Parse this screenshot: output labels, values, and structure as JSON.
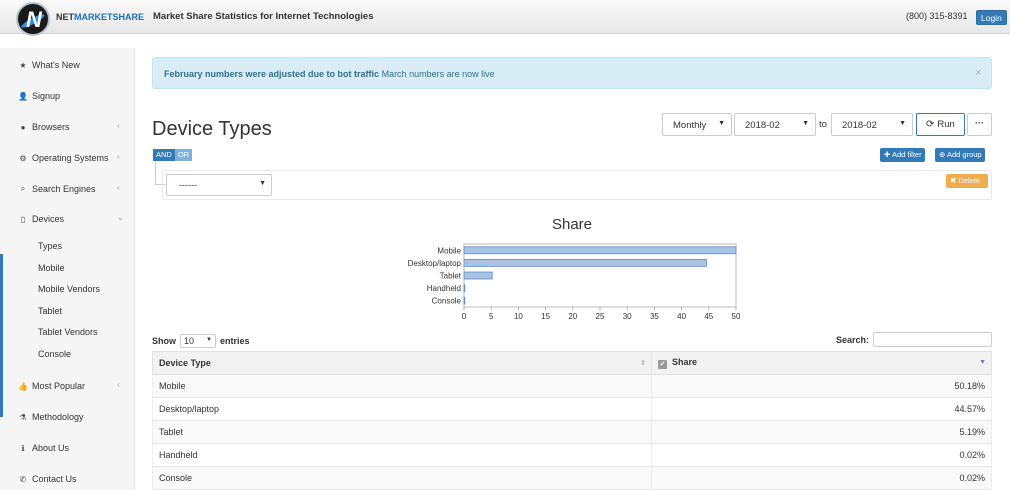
{
  "header": {
    "brand_part1": "NET",
    "brand_part2": "MARKETSHARE",
    "tagline": "Market Share Statistics for Internet Technologies",
    "phone": "(800) 315-8391",
    "login_label": "Login"
  },
  "sidebar": {
    "items": [
      {
        "label": "What's New",
        "icon": "star-icon"
      },
      {
        "label": "Signup",
        "icon": "user-plus-icon"
      },
      {
        "label": "Browsers",
        "icon": "globe-icon"
      },
      {
        "label": "Operating Systems",
        "icon": "cog-icon"
      },
      {
        "label": "Search Engines",
        "icon": "search-icon"
      },
      {
        "label": "Devices",
        "icon": "tablet-icon"
      },
      {
        "label": "Most Popular",
        "icon": "thumbs-up-icon"
      },
      {
        "label": "Methodology",
        "icon": "flask-icon"
      },
      {
        "label": "About Us",
        "icon": "info-icon"
      },
      {
        "label": "Contact Us",
        "icon": "phone-icon"
      }
    ],
    "devices_sub": [
      "Types",
      "Mobile",
      "Mobile Vendors",
      "Tablet",
      "Tablet Vendors",
      "Console"
    ]
  },
  "alert": {
    "bold_text": "February numbers were adjusted due to bot traffic",
    "text": "March numbers are now live",
    "close": "×"
  },
  "page_title": "Device Types",
  "controls": {
    "period": "Monthly",
    "from": "2018-02",
    "to_label": "to",
    "to": "2018-02",
    "run_label": "Run",
    "more_label": "···"
  },
  "filter": {
    "and_label": "AND",
    "or_label": "OR",
    "placeholder": "------",
    "add_filter": "Add filter",
    "add_group": "Add group",
    "delete": "Delete"
  },
  "chart_data": {
    "type": "bar",
    "orientation": "horizontal",
    "title": "Share",
    "categories": [
      "Mobile",
      "Desktop/laptop",
      "Tablet",
      "Handheld",
      "Console"
    ],
    "values": [
      50.18,
      44.57,
      5.19,
      0.02,
      0.02
    ],
    "xlim": [
      0,
      50
    ],
    "xticks": [
      0,
      5,
      10,
      15,
      20,
      25,
      30,
      35,
      40,
      45,
      50
    ],
    "bar_color": "#a6c4e6",
    "bar_stroke": "#5f8fc6"
  },
  "table_controls": {
    "show_label": "Show",
    "entries_value": "10",
    "entries_label": "entries",
    "search_label": "Search:"
  },
  "table": {
    "columns": [
      "Device Type",
      "Share"
    ],
    "rows": [
      [
        "Mobile",
        "50.18%"
      ],
      [
        "Desktop/laptop",
        "44.57%"
      ],
      [
        "Tablet",
        "5.19%"
      ],
      [
        "Handheld",
        "0.02%"
      ],
      [
        "Console",
        "0.02%"
      ]
    ]
  }
}
